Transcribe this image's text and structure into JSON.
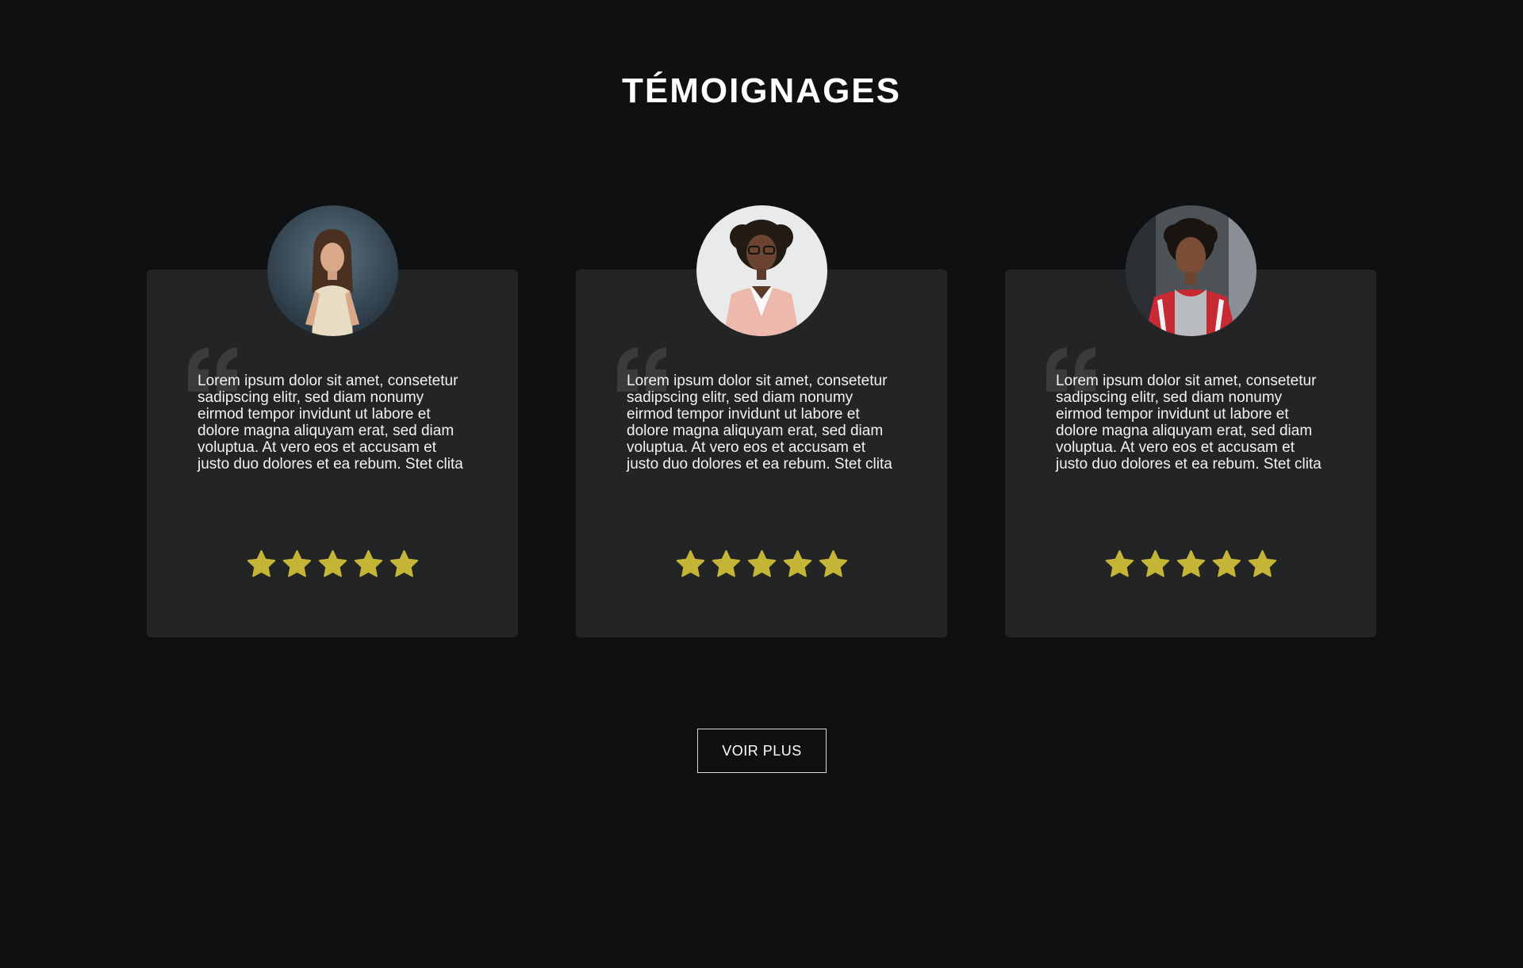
{
  "section": {
    "title": "TÉMOIGNAGES"
  },
  "testimonials": [
    {
      "text": "Lorem ipsum dolor sit amet, consetetur sadipscing elitr, sed diam nonumy eirmod tempor invidunt ut labore et dolore magna aliquyam erat, sed diam voluptua. At vero eos et accusam et justo duo dolores et ea rebum. Stet clita",
      "rating": 5,
      "rating_max": 5
    },
    {
      "text": "Lorem ipsum dolor sit amet, consetetur sadipscing elitr, sed diam nonumy eirmod tempor invidunt ut labore et dolore magna aliquyam erat, sed diam voluptua. At vero eos et accusam et justo duo dolores et ea rebum. Stet clita",
      "rating": 5,
      "rating_max": 5
    },
    {
      "text": "Lorem ipsum dolor sit amet, consetetur sadipscing elitr, sed diam nonumy eirmod tempor invidunt ut labore et dolore magna aliquyam erat, sed diam voluptua. At vero eos et accusam et justo duo dolores et ea rebum. Stet clita",
      "rating": 5,
      "rating_max": 5
    }
  ],
  "actions": {
    "more_label": "VOIR PLUS"
  },
  "colors": {
    "background": "#0f1012",
    "card": "#232426",
    "star": "#c4b536",
    "quote": "#3a3b3d"
  }
}
